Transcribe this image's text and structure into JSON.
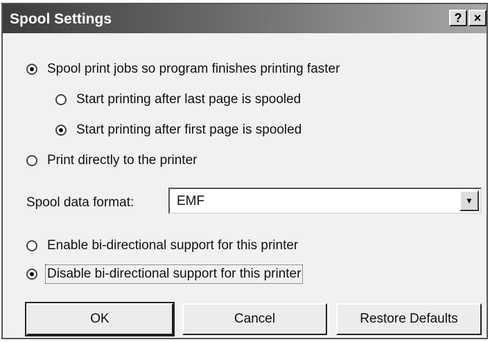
{
  "window": {
    "title": "Spool Settings",
    "help_button": "?",
    "close_button": "×"
  },
  "options": {
    "spool": "Spool print jobs so program finishes printing faster",
    "after_last": "Start printing after last page is spooled",
    "after_first": "Start printing after first page is spooled",
    "direct": "Print directly to the printer",
    "enable_bidi": "Enable bi-directional support for this printer",
    "disable_bidi": "Disable bi-directional support for this printer"
  },
  "format": {
    "label": "Spool data format:",
    "value": "EMF"
  },
  "buttons": {
    "ok": "OK",
    "cancel": "Cancel",
    "restore": "Restore Defaults"
  }
}
